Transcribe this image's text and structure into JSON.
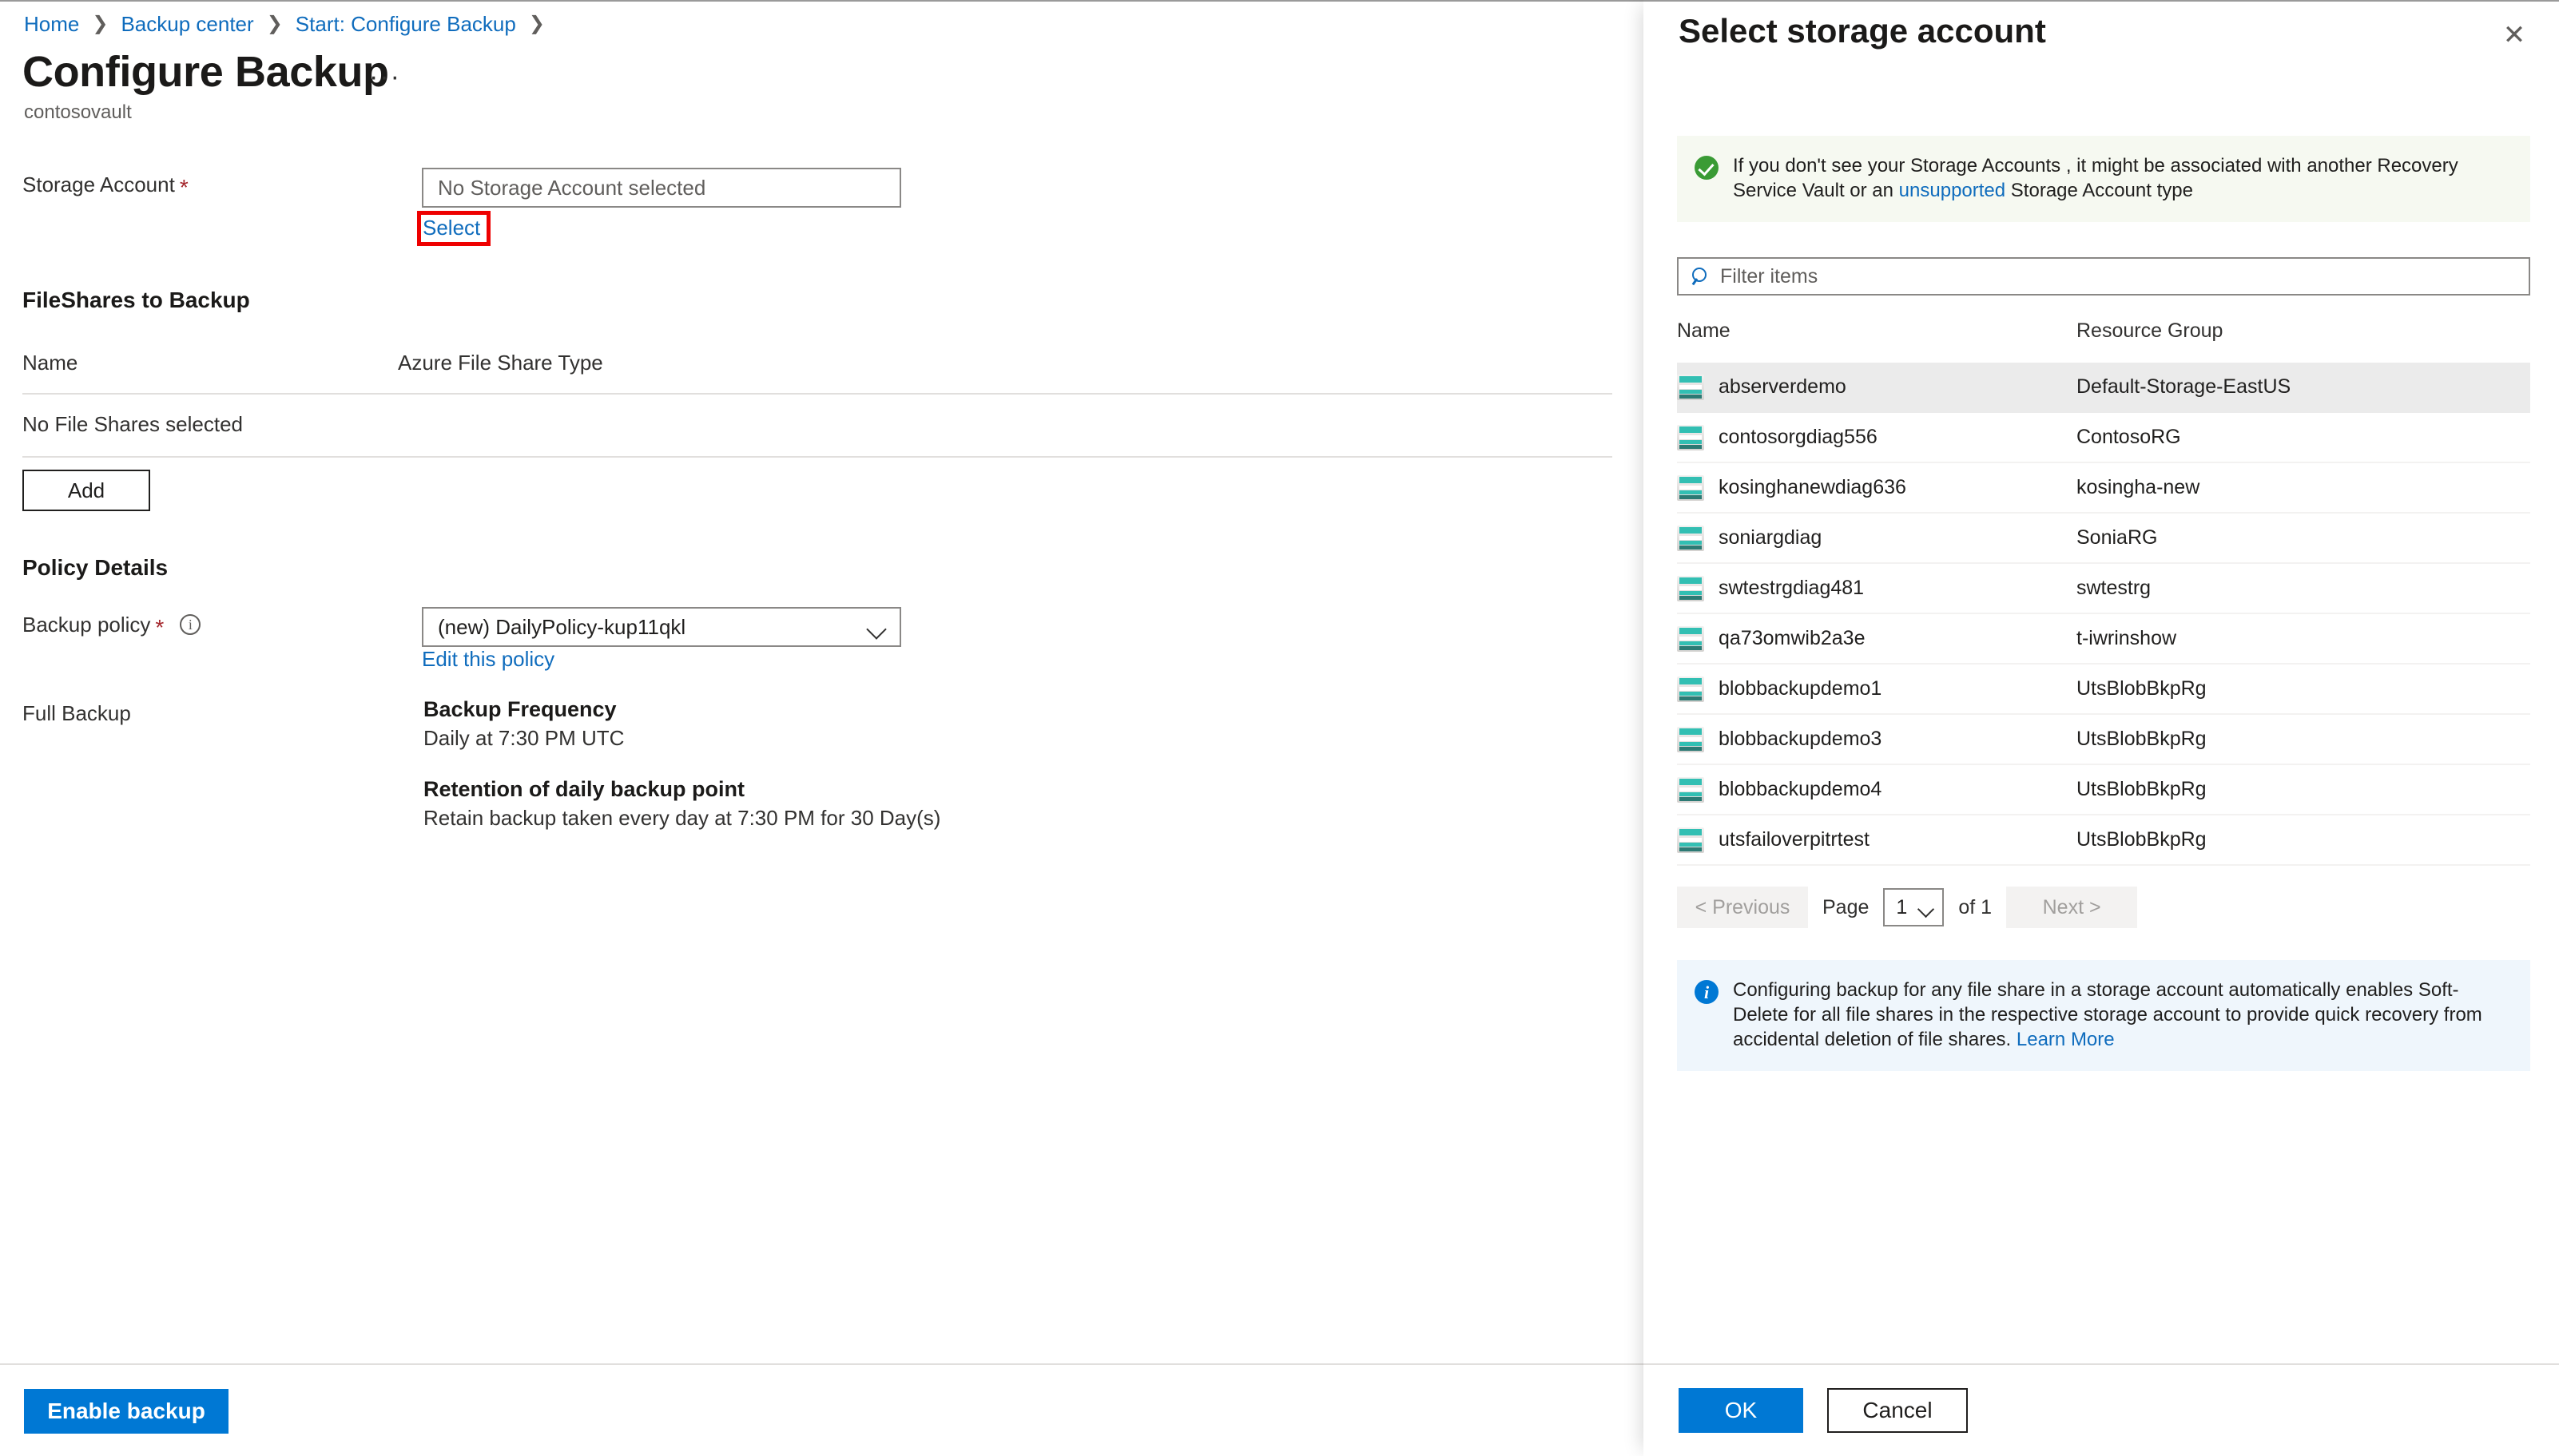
{
  "breadcrumb": {
    "items": [
      "Home",
      "Backup center",
      "Start: Configure Backup"
    ],
    "separator": "❯"
  },
  "header": {
    "title": "Configure Backup",
    "ellipsis": "···",
    "subtitle": "contosovault"
  },
  "storage_account": {
    "label": "Storage Account",
    "required_mark": "*",
    "value": "No Storage Account selected",
    "select_link": "Select"
  },
  "fileshares": {
    "section_title": "FileShares to Backup",
    "columns": [
      "Name",
      "Azure File Share Type"
    ],
    "rows": [
      {
        "name": "No File Shares selected",
        "type": ""
      }
    ],
    "add_button": "Add"
  },
  "policy": {
    "section_title": "Policy Details",
    "backup_policy_label": "Backup policy",
    "required_mark": "*",
    "info_glyph": "i",
    "selected_policy": "(new) DailyPolicy-kup11qkl",
    "edit_link": "Edit this policy",
    "full_backup_label": "Full Backup",
    "frequency_heading": "Backup Frequency",
    "frequency_value": "Daily at 7:30 PM UTC",
    "retention_heading": "Retention of daily backup point",
    "retention_value": "Retain backup taken every day at 7:30 PM for 30 Day(s)"
  },
  "main_footer": {
    "enable_backup": "Enable backup"
  },
  "panel": {
    "title": "Select storage account",
    "close_glyph": "✕",
    "success_banner": {
      "text_before": "If you don't see your Storage Accounts , it might be associated with another Recovery Service Vault or an",
      "link": "unsupported",
      "text_after": "Storage Account type"
    },
    "filter": {
      "placeholder": "Filter items",
      "value": ""
    },
    "columns": [
      "Name",
      "Resource Group"
    ],
    "rows": [
      {
        "name": "abserverdemo",
        "resource_group": "Default-Storage-EastUS",
        "selected": true
      },
      {
        "name": "contosorgdiag556",
        "resource_group": "ContosoRG",
        "selected": false
      },
      {
        "name": "kosinghanewdiag636",
        "resource_group": "kosingha-new",
        "selected": false
      },
      {
        "name": "soniargdiag",
        "resource_group": "SoniaRG",
        "selected": false
      },
      {
        "name": "swtestrgdiag481",
        "resource_group": "swtestrg",
        "selected": false
      },
      {
        "name": "qa73omwib2a3e",
        "resource_group": "t-iwrinshow",
        "selected": false
      },
      {
        "name": "blobbackupdemo1",
        "resource_group": "UtsBlobBkpRg",
        "selected": false
      },
      {
        "name": "blobbackupdemo3",
        "resource_group": "UtsBlobBkpRg",
        "selected": false
      },
      {
        "name": "blobbackupdemo4",
        "resource_group": "UtsBlobBkpRg",
        "selected": false
      },
      {
        "name": "utsfailoverpitrtest",
        "resource_group": "UtsBlobBkpRg",
        "selected": false
      }
    ],
    "pagination": {
      "previous": "< Previous",
      "page_label": "Page",
      "current_page": "1",
      "of_label": "of 1",
      "next": "Next >"
    },
    "info_banner": {
      "text": "Configuring backup for any file share in a storage account automatically enables Soft-Delete for all file shares in the respective storage account to provide quick recovery from accidental deletion of file shares.",
      "link": "Learn More",
      "glyph": "i"
    },
    "footer": {
      "ok": "OK",
      "cancel": "Cancel"
    }
  },
  "colors": {
    "accent_blue": "#0078d4",
    "link_blue": "#0f6cbd",
    "required_red": "#a4262c",
    "highlight_red": "#ee0000",
    "success_green": "#3a9b35",
    "storage_teal": "#32bfb3",
    "selected_row_bg": "#ebebeb"
  }
}
